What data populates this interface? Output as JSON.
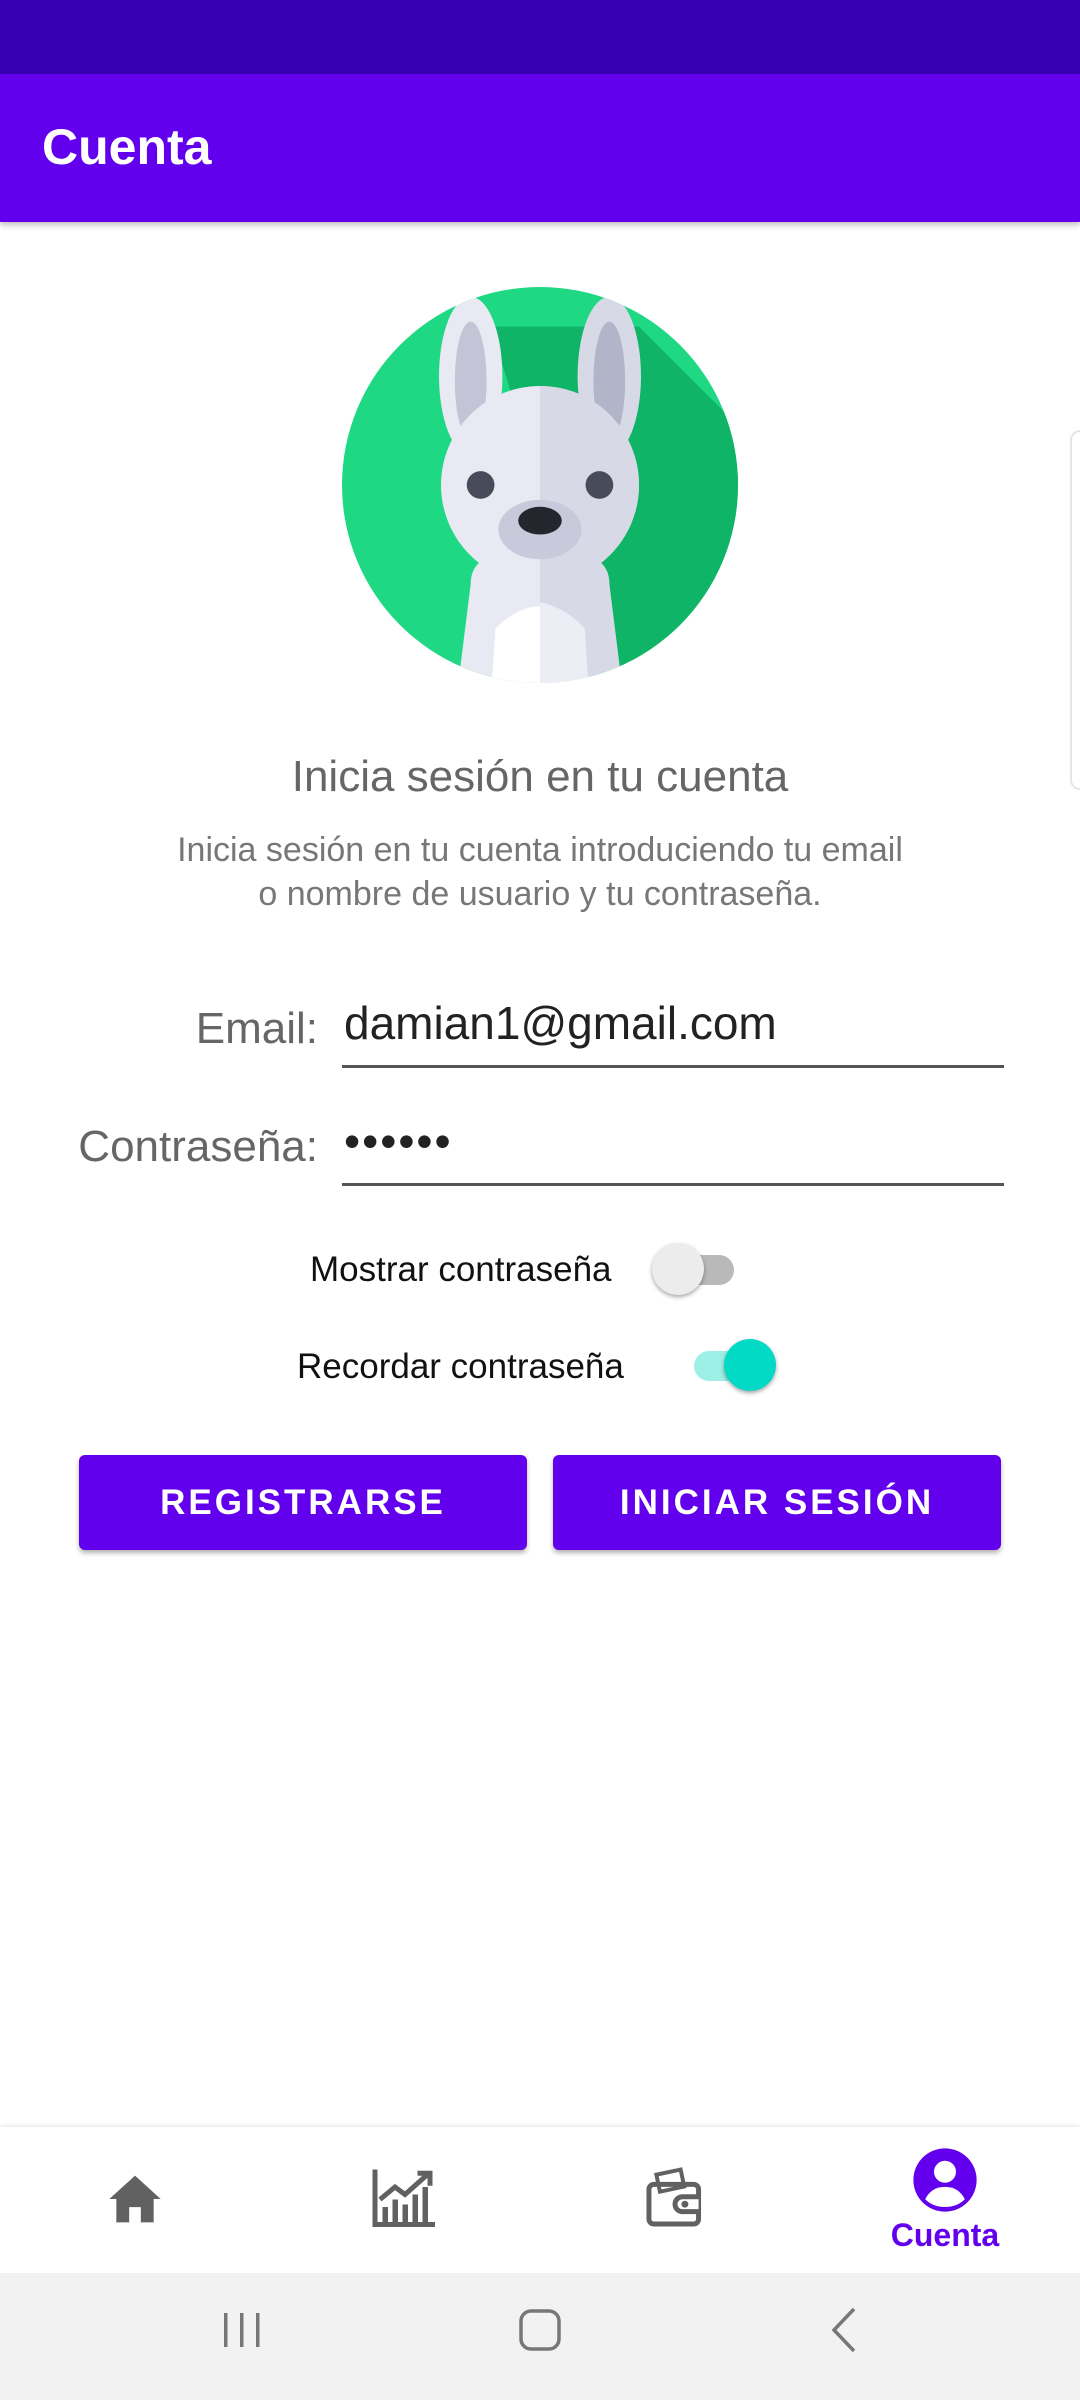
{
  "app_bar": {
    "title": "Cuenta"
  },
  "login": {
    "heading": "Inicia sesión en tu cuenta",
    "subtext_line1": "Inicia sesión en tu cuenta introduciendo tu email",
    "subtext_line2": "o nombre de usuario y tu contraseña.",
    "email_label": "Email:",
    "email_value": "damian1@gmail.com",
    "password_label": "Contraseña:",
    "password_value": "••••••",
    "show_password_label": "Mostrar contraseña",
    "show_password_on": false,
    "remember_password_label": "Recordar contraseña",
    "remember_password_on": true,
    "register_label": "REGISTRARSE",
    "login_label": "INICIAR SESIÓN"
  },
  "bottom_nav": {
    "items": [
      {
        "icon": "home-icon",
        "label": "",
        "selected": false
      },
      {
        "icon": "chart-icon",
        "label": "",
        "selected": false
      },
      {
        "icon": "wallet-icon",
        "label": "",
        "selected": false
      },
      {
        "icon": "account-icon",
        "label": "Cuenta",
        "selected": true
      }
    ]
  },
  "colors": {
    "status_bar": "#3700b3",
    "primary": "#6200ee",
    "avatar_bg": "#1fd884",
    "switch_on": "#03dac5",
    "switch_off": "#ececec"
  }
}
